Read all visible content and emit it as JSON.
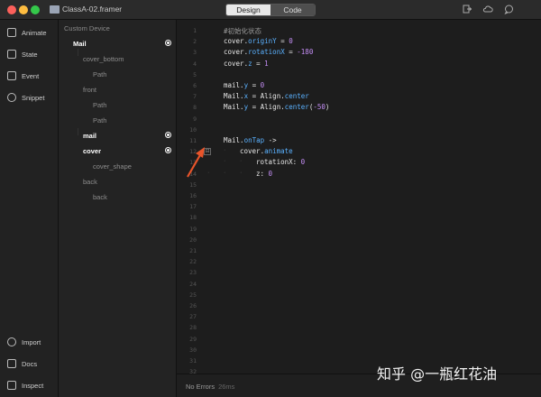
{
  "window": {
    "file_title": "ClassA-02.framer",
    "mode_tabs": [
      "Design",
      "Code"
    ],
    "active_tab": "Code",
    "toolbar_icons": [
      "export-icon",
      "cloud-icon",
      "chat-icon"
    ]
  },
  "sidebar": {
    "top_items": [
      {
        "label": "Animate",
        "icon": "animate-icon"
      },
      {
        "label": "State",
        "icon": "state-icon"
      },
      {
        "label": "Event",
        "icon": "event-icon"
      },
      {
        "label": "Snippet",
        "icon": "snippet-icon"
      }
    ],
    "bottom_items": [
      {
        "label": "Import",
        "icon": "import-icon"
      },
      {
        "label": "Docs",
        "icon": "docs-icon"
      },
      {
        "label": "Inspect",
        "icon": "inspect-icon"
      }
    ]
  },
  "layers": {
    "header": "Custom Device",
    "items": [
      {
        "name": "Mail",
        "has_event": true,
        "bold": true
      },
      {
        "name": "cover_bottom",
        "has_event": false,
        "bold": false
      },
      {
        "name": "Path",
        "has_event": false,
        "bold": false
      },
      {
        "name": "front",
        "has_event": false,
        "bold": false
      },
      {
        "name": "Path",
        "has_event": false,
        "bold": false
      },
      {
        "name": "Path",
        "has_event": false,
        "bold": false
      },
      {
        "name": "mail",
        "has_event": true,
        "bold": true
      },
      {
        "name": "cover",
        "has_event": true,
        "bold": true
      },
      {
        "name": "cover_shape",
        "has_event": false,
        "bold": false
      },
      {
        "name": "back",
        "has_event": false,
        "bold": false
      },
      {
        "name": "back",
        "has_event": false,
        "bold": false
      }
    ]
  },
  "editor": {
    "line_numbers": [
      "1",
      "2",
      "3",
      "4",
      "5",
      "6",
      "7",
      "8",
      "9",
      "10",
      "11",
      "12",
      "13",
      "14",
      "15",
      "16",
      "17",
      "18",
      "19",
      "20",
      "21",
      "22",
      "23",
      "24",
      "25",
      "26",
      "27",
      "28",
      "29",
      "30",
      "31",
      "32"
    ],
    "code": {
      "l1": "#初始化状态",
      "l2_obj": "cover.",
      "l2_prop": "originY",
      "l2_op": " = ",
      "l2_val": "0",
      "l3_obj": "cover.",
      "l3_prop": "rotationX",
      "l3_op": " = ",
      "l3_val": "-180",
      "l4_obj": "cover.",
      "l4_prop": "z",
      "l4_op": " = ",
      "l4_val": "1",
      "l6_obj": "mail.",
      "l6_prop": "y",
      "l6_op": " = ",
      "l6_val": "0",
      "l7_obj": "Mail.",
      "l7_prop": "x",
      "l7_op": " = Align.",
      "l7_val": "center",
      "l8_obj": "Mail.",
      "l8_prop": "y",
      "l8_op": " = Align.",
      "l8_fn": "center",
      "l8_paren_open": "(",
      "l8_val": "-50",
      "l8_paren_close": ")",
      "l11_obj": "Mail.",
      "l11_prop": "onTap",
      "l11_rest": " ->",
      "l12_obj": "cover.",
      "l12_prop": "animate",
      "l13_key": "rotationX:",
      "l13_val": " 0",
      "l14_key": "z:",
      "l14_val": " 0"
    },
    "fold_marker": "⊟"
  },
  "status": {
    "text": "No Errors",
    "time": "26ms"
  },
  "watermark": "知乎 @一瓶红花油",
  "colors": {
    "accent_property": "#5ab1ff",
    "number": "#c48ef5",
    "annotation_arrow": "#e8542a"
  }
}
